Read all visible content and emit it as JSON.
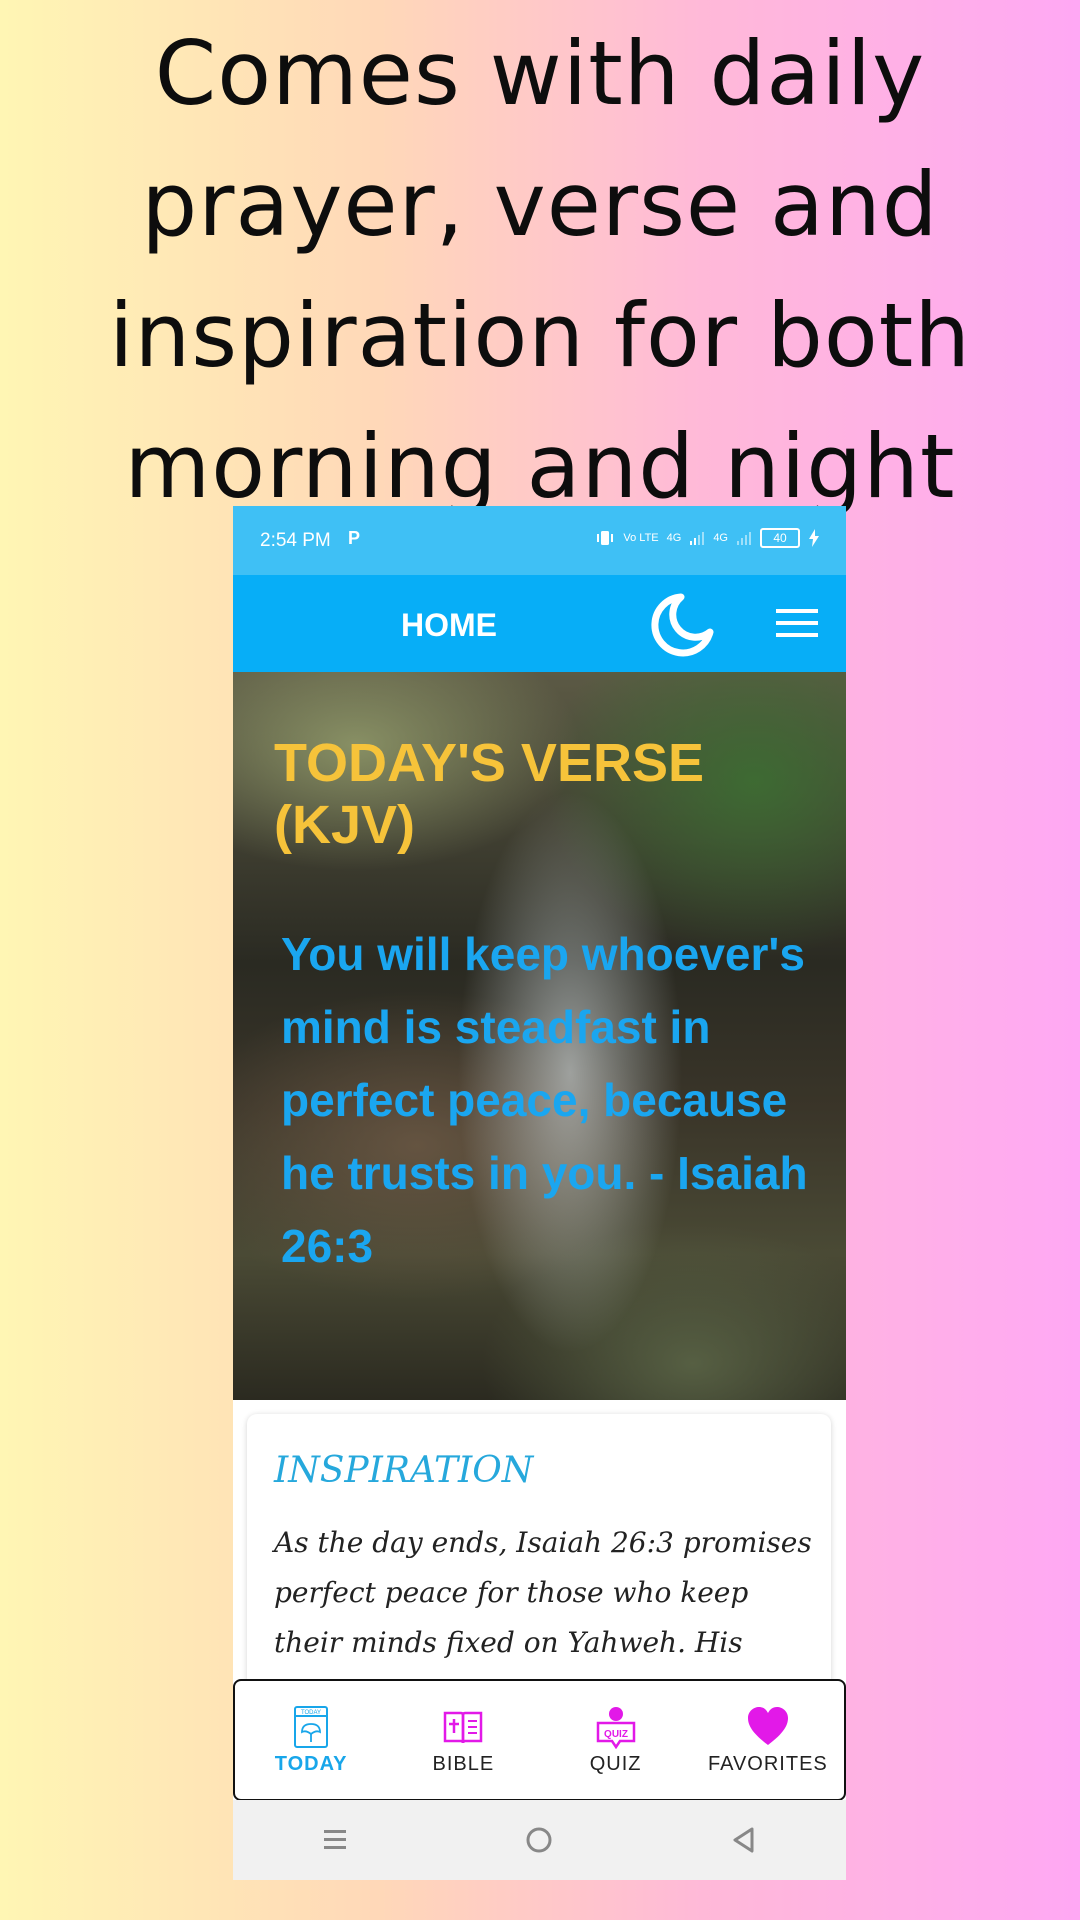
{
  "promo": {
    "headline_lines": [
      "Comes with daily",
      "prayer, verse and",
      "inspiration for both",
      "morning and night"
    ]
  },
  "status_bar": {
    "time": "2:54 PM",
    "app_icon": "P",
    "network1": "Vo LTE",
    "network2": "4G",
    "network3": "4G",
    "battery": "40"
  },
  "app_bar": {
    "title": "HOME",
    "icons": [
      "moon-icon",
      "hamburger-menu-icon"
    ]
  },
  "hero": {
    "verse_title": "TODAY'S VERSE (KJV)",
    "verse_text": "You will keep whoever's mind is steadfast in perfect peace, because he trusts in you. - Isaiah 26:3"
  },
  "inspiration": {
    "title": "INSPIRATION",
    "body": "As the day ends, Isaiah 26:3 promises perfect peace for those who keep their minds fixed on Yahweh. His peace"
  },
  "bottom_nav": {
    "items": [
      {
        "label": "TODAY",
        "icon": "today-icon",
        "active": true
      },
      {
        "label": "BIBLE",
        "icon": "bible-icon",
        "active": false
      },
      {
        "label": "QUIZ",
        "icon": "quiz-icon",
        "active": false
      },
      {
        "label": "FAVORITES",
        "icon": "heart-icon",
        "active": false
      }
    ],
    "today_icon_text": "TODAY",
    "quiz_icon_text": "QUIZ"
  },
  "system_nav": {
    "buttons": [
      "recents-icon",
      "home-icon",
      "back-icon"
    ]
  },
  "colors": {
    "status_bar": "#3fc0f5",
    "app_bar": "#07aef7",
    "verse_title": "#f6c33a",
    "verse_text": "#1aa6f0",
    "inspiration_title": "#26a8dc",
    "magenta_icons": "#e219e8"
  }
}
